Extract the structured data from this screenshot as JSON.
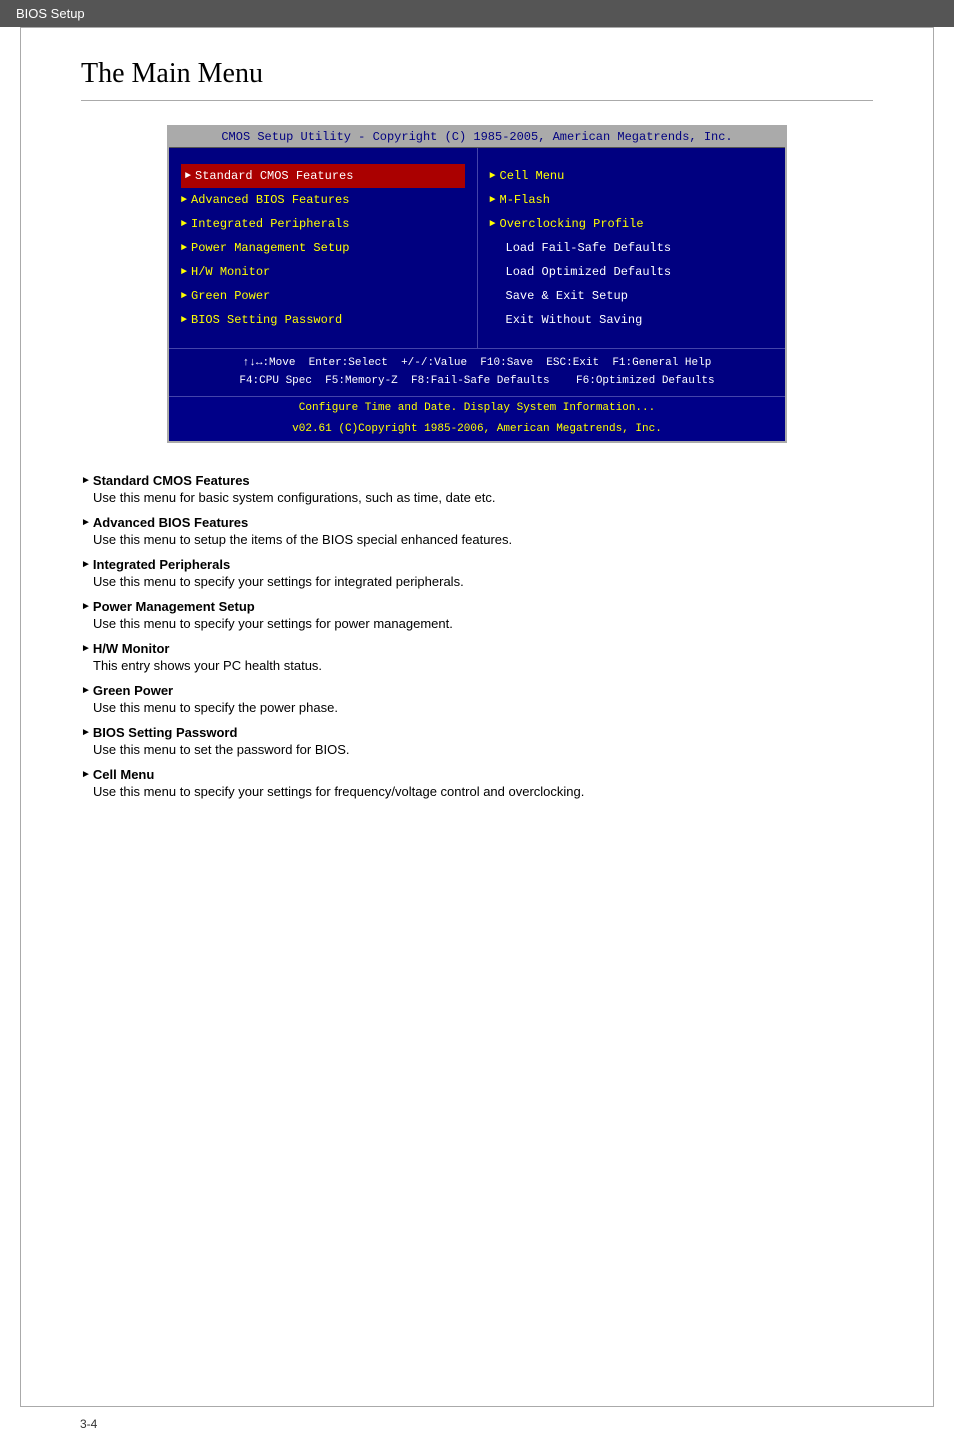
{
  "header": {
    "title": "BIOS Setup"
  },
  "page": {
    "title": "The Main Menu",
    "footer_page": "3-4"
  },
  "bios": {
    "title_bar": "CMOS Setup Utility - Copyright (C) 1985-2005, American Megatrends, Inc.",
    "left_menu": [
      {
        "id": "standard-cmos",
        "label": "Standard CMOS Features",
        "has_arrow": true,
        "selected": true
      },
      {
        "id": "advanced-bios",
        "label": "Advanced BIOS Features",
        "has_arrow": true,
        "selected": false
      },
      {
        "id": "integrated-peripherals",
        "label": "Integrated Peripherals",
        "has_arrow": true,
        "selected": false
      },
      {
        "id": "power-management",
        "label": "Power Management Setup",
        "has_arrow": true,
        "selected": false
      },
      {
        "id": "hw-monitor",
        "label": "H/W Monitor",
        "has_arrow": true,
        "selected": false
      },
      {
        "id": "green-power",
        "label": "Green Power",
        "has_arrow": true,
        "selected": false
      },
      {
        "id": "bios-password",
        "label": "BIOS Setting Password",
        "has_arrow": true,
        "selected": false
      }
    ],
    "right_menu": [
      {
        "id": "cell-menu",
        "label": "Cell Menu",
        "has_arrow": true
      },
      {
        "id": "m-flash",
        "label": "M-Flash",
        "has_arrow": true
      },
      {
        "id": "overclocking-profile",
        "label": "Overclocking Profile",
        "has_arrow": true
      },
      {
        "id": "load-failsafe",
        "label": "Load Fail-Safe Defaults",
        "has_arrow": false
      },
      {
        "id": "load-optimized",
        "label": "Load Optimized Defaults",
        "has_arrow": false
      },
      {
        "id": "save-exit",
        "label": "Save & Exit Setup",
        "has_arrow": false
      },
      {
        "id": "exit-without-saving",
        "label": "Exit Without Saving",
        "has_arrow": false
      }
    ],
    "footer_nav": "↑↓↔:Move  Enter:Select  +/-/:Value  F10:Save  ESC:Exit  F1:General Help\n    F4:CPU Spec  F5:Memory-Z  F8:Fail-Safe Defaults    F6:Optimized Defaults",
    "footer_info": "Configure Time and Date.  Display System Information...",
    "footer_copy": "v02.61 (C)Copyright 1985-2006, American Megatrends, Inc."
  },
  "descriptions": [
    {
      "id": "standard-cmos",
      "title": "Standard CMOS Features",
      "text": "Use this menu for basic system configurations, such as time, date etc."
    },
    {
      "id": "advanced-bios",
      "title": "Advanced BIOS Features",
      "text": "Use this menu to setup the items of the BIOS special enhanced features."
    },
    {
      "id": "integrated-peripherals",
      "title": "Integrated Peripherals",
      "text": "Use this menu to specify your settings for integrated peripherals."
    },
    {
      "id": "power-management",
      "title": "Power Management Setup",
      "text": "Use this menu to specify your settings for power management."
    },
    {
      "id": "hw-monitor",
      "title": "H/W Monitor",
      "text": "This entry shows your PC health status."
    },
    {
      "id": "green-power",
      "title": "Green Power",
      "text": "Use this menu to specify the power phase."
    },
    {
      "id": "bios-password",
      "title": "BIOS Setting Password",
      "text": "Use this menu to set the password for BIOS."
    },
    {
      "id": "cell-menu",
      "title": "Cell Menu",
      "text": "Use this menu to specify your settings for frequency/voltage control and overclocking."
    }
  ]
}
